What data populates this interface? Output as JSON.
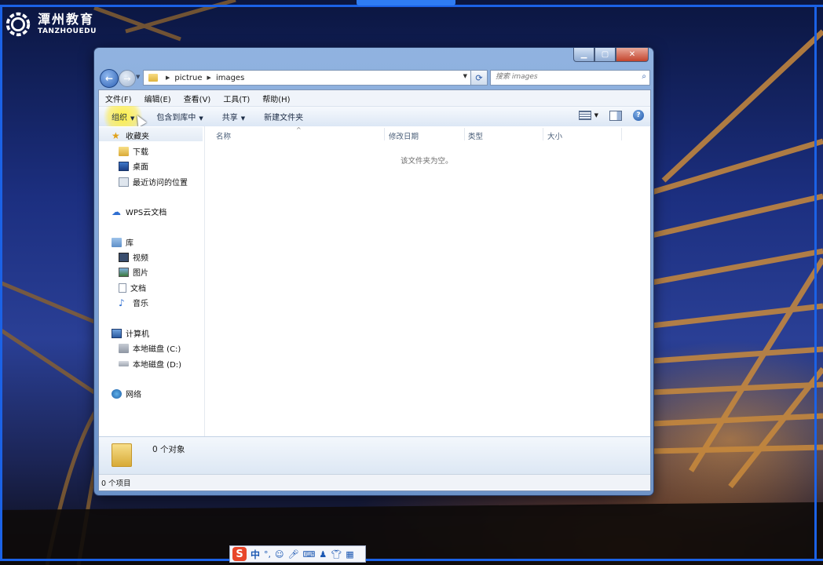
{
  "logo": {
    "name_cn": "潭州教育",
    "name_en": "TANZHOUEDU"
  },
  "window": {
    "breadcrumb": [
      "pictrue",
      "images"
    ],
    "search_placeholder": "搜索 images",
    "menu": [
      "文件(F)",
      "编辑(E)",
      "查看(V)",
      "工具(T)",
      "帮助(H)"
    ],
    "commands": {
      "organize": "组织",
      "include_library": "包含到库中",
      "share": "共享",
      "new_folder": "新建文件夹"
    },
    "nav": {
      "favorites": "收藏夹",
      "downloads": "下载",
      "desktop": "桌面",
      "recent": "最近访问的位置",
      "wps_cloud": "WPS云文档",
      "libraries": "库",
      "videos": "视频",
      "pictures": "图片",
      "documents": "文档",
      "music": "音乐",
      "computer": "计算机",
      "disk_c": "本地磁盘 (C:)",
      "disk_d": "本地磁盘 (D:)",
      "network": "网络"
    },
    "columns": {
      "name": "名称",
      "modified": "修改日期",
      "type": "类型",
      "size": "大小"
    },
    "empty_message": "该文件夹为空。",
    "details_text": "0 个对象",
    "status_text": "0 个项目"
  },
  "ime": {
    "logo": "S",
    "mode": "中"
  },
  "colors": {
    "frame": "#1b62e6",
    "highlight": "#fff03c",
    "ime_logo": "#e8462a"
  }
}
